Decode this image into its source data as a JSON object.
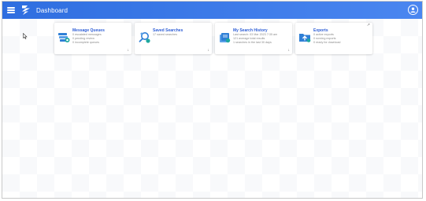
{
  "header": {
    "title": "Dashboard",
    "menu_icon": "hamburger-menu-icon",
    "logo_icon": "app-logo-icon",
    "profile_icon": "user-profile-icon",
    "accent_color": "#3a7be8"
  },
  "cards": [
    {
      "title": "Message Queues",
      "lines": [
        "0 escalated messages",
        "0 pending review",
        "0 incomplete queues"
      ],
      "icon": "message-queue-icon",
      "corner_icon": "download-icon"
    },
    {
      "title": "Saved Searches",
      "lines": [
        "17 saved searches"
      ],
      "icon": "saved-search-icon",
      "corner_icon": "download-icon"
    },
    {
      "title": "My Search History",
      "lines": [
        "Last search: 03 Mar 2023 7:35 am",
        "121 average total results",
        "1 searches in the last 30 days"
      ],
      "icon": "search-history-icon",
      "corner_icon": "download-icon"
    },
    {
      "title": "Exports",
      "lines": [
        "0 active exports",
        "0 running exports",
        "0 ready for download"
      ],
      "icon": "exports-icon",
      "corner_icon": "open-external-icon"
    }
  ]
}
